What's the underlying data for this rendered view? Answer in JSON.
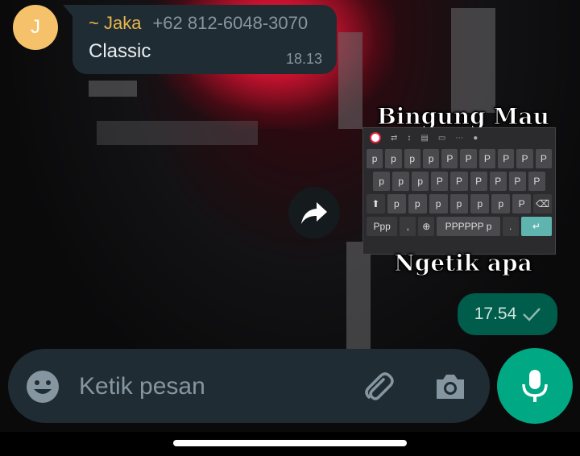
{
  "chat": {
    "incoming": {
      "avatar_initial": "J",
      "sender_name": "~ Jaka",
      "sender_phone": "+62 812-6048-3070",
      "text": "Classic",
      "time": "18.13"
    },
    "sticker": {
      "top_text": "Bingung Mau",
      "bottom_text": "Ngetik apa",
      "keyboard": {
        "row1": [
          "p",
          "p",
          "p",
          "p",
          "P",
          "P",
          "P",
          "P",
          "P",
          "P"
        ],
        "row2": [
          "p",
          "p",
          "p",
          "P",
          "P",
          "P",
          "P",
          "P",
          "P"
        ],
        "row3": [
          "p",
          "p",
          "p",
          "p",
          "p",
          "p",
          "P"
        ],
        "ppp_key": "Ppp",
        "comma_key": ",",
        "space_key": "PPPPPP p",
        "period_key": "."
      }
    },
    "outgoing": {
      "time": "17.54"
    }
  },
  "composer": {
    "placeholder": "Ketik pesan"
  },
  "colors": {
    "accent": "#00a884",
    "bubble_in": "#1f2c34",
    "bubble_out": "#005c4b",
    "sender_name": "#e8b64a",
    "avatar": "#f5c26b"
  },
  "icons": {
    "forward": "forward-icon",
    "emoji": "emoji-icon",
    "attach": "paperclip-icon",
    "camera": "camera-icon",
    "mic": "mic-icon",
    "read": "check-icon"
  }
}
